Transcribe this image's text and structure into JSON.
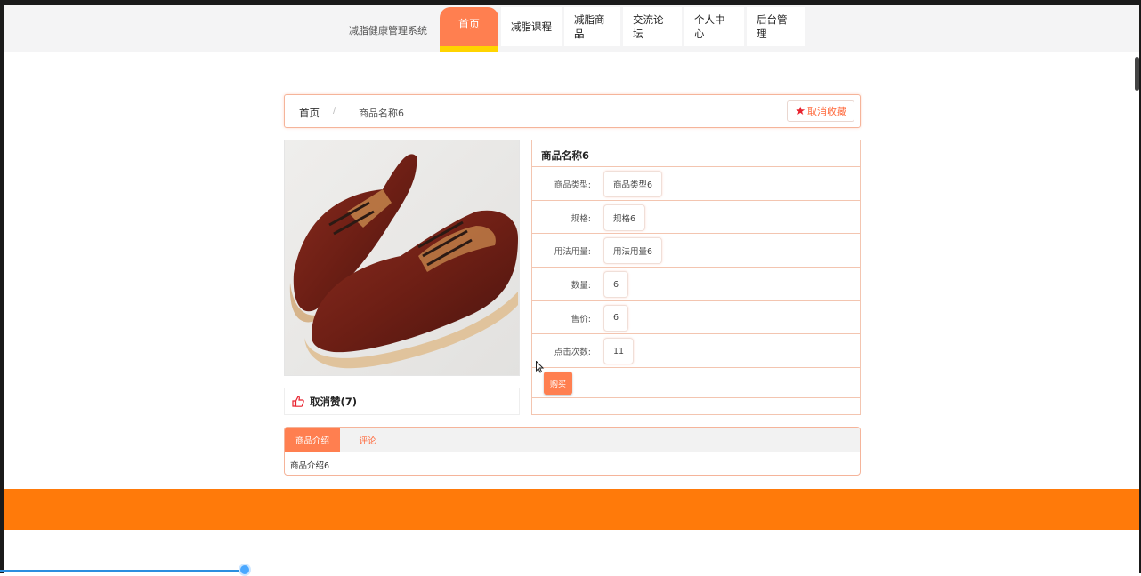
{
  "header": {
    "brand": "减脂健康管理系统",
    "nav": [
      {
        "label": "首页"
      },
      {
        "label": "减脂课程"
      },
      {
        "label": "减脂商品"
      },
      {
        "label": "交流论坛"
      },
      {
        "label": "个人中心"
      },
      {
        "label": "后台管理"
      }
    ]
  },
  "breadcrumb": {
    "home": "首页",
    "separator": "/",
    "current": "商品名称6"
  },
  "favorite": {
    "label": "取消收藏",
    "icon": "star-icon"
  },
  "product": {
    "image_icon": "brown-leather-shoes-image",
    "like_label": "取消赞(7)",
    "like_icon": "thumbs-up-icon",
    "title": "商品名称6",
    "fields": [
      {
        "label": "商品类型:",
        "value": "商品类型6"
      },
      {
        "label": "规格:",
        "value": "规格6"
      },
      {
        "label": "用法用量:",
        "value": "用法用量6"
      },
      {
        "label": "数量:",
        "value": "6"
      },
      {
        "label": "售价:",
        "value": "6"
      },
      {
        "label": "点击次数:",
        "value": "11"
      }
    ],
    "buy_label": "购买"
  },
  "tabs": {
    "items": [
      {
        "label": "商品介绍"
      },
      {
        "label": "评论"
      }
    ],
    "content": "商品介绍6"
  },
  "colors": {
    "accent": "#ff7f50",
    "footer": "#ff7a0a",
    "nav_underline": "#ffd400"
  }
}
